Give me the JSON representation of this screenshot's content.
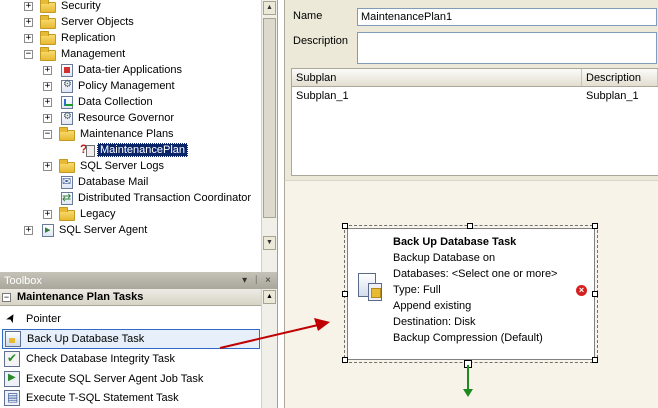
{
  "tree": {
    "items": [
      {
        "label": "Security",
        "icon": "folder-icon",
        "expander": "+"
      },
      {
        "label": "Server Objects",
        "icon": "folder-icon",
        "expander": "+"
      },
      {
        "label": "Replication",
        "icon": "folder-icon",
        "expander": "+"
      },
      {
        "label": "Management",
        "icon": "folder-icon",
        "expander": "−"
      },
      {
        "label": "Data-tier Applications",
        "icon": "data-tier-icon",
        "expander": "+"
      },
      {
        "label": "Policy Management",
        "icon": "policy-icon",
        "expander": "+"
      },
      {
        "label": "Data Collection",
        "icon": "data-collection-icon",
        "expander": "+"
      },
      {
        "label": "Resource Governor",
        "icon": "resource-governor-icon",
        "expander": "+"
      },
      {
        "label": "Maintenance Plans",
        "icon": "folder-icon",
        "expander": "−"
      },
      {
        "label": "MaintenancePlan",
        "icon": "maintenance-plan-icon",
        "expander": ""
      },
      {
        "label": "SQL Server Logs",
        "icon": "folder-icon",
        "expander": "+"
      },
      {
        "label": "Database Mail",
        "icon": "database-mail-icon",
        "expander": ""
      },
      {
        "label": "Distributed Transaction Coordinator",
        "icon": "dtc-icon",
        "expander": ""
      },
      {
        "label": "Legacy",
        "icon": "folder-icon",
        "expander": "+"
      },
      {
        "label": "SQL Server Agent",
        "icon": "sql-agent-icon",
        "expander": "+"
      }
    ]
  },
  "toolbox": {
    "title": "Toolbox",
    "controls": [
      "▾",
      "ᛁ",
      "×"
    ],
    "group_label": "Maintenance Plan Tasks",
    "group_expander": "−",
    "items": [
      {
        "label": "Pointer",
        "icon": "pointer-icon"
      },
      {
        "label": "Back Up Database Task",
        "icon": "backup-database-icon"
      },
      {
        "label": "Check Database Integrity Task",
        "icon": "check-integrity-icon"
      },
      {
        "label": "Execute SQL Server Agent Job Task",
        "icon": "agent-job-icon"
      },
      {
        "label": "Execute T-SQL Statement Task",
        "icon": "tsql-icon"
      }
    ]
  },
  "properties": {
    "name_label": "Name",
    "name_value": "MaintenancePlan1",
    "description_label": "Description",
    "description_value": "",
    "grid_headers": [
      "Subplan",
      "Description"
    ],
    "grid_rows": [
      [
        "Subplan_1",
        "Subplan_1"
      ]
    ]
  },
  "task": {
    "title": "Back Up Database Task",
    "lines": [
      "Backup Database on",
      "Databases: <Select one or more>",
      "Type: Full",
      "Append existing",
      "Destination: Disk",
      "Backup Compression (Default)"
    ],
    "error_glyph": "×"
  },
  "scroll_glyphs": {
    "up": "▲",
    "down": "▼"
  },
  "colors": {
    "selection": "#0a246a",
    "drag_arrow": "#c00000",
    "connector": "#1f8a1f"
  }
}
